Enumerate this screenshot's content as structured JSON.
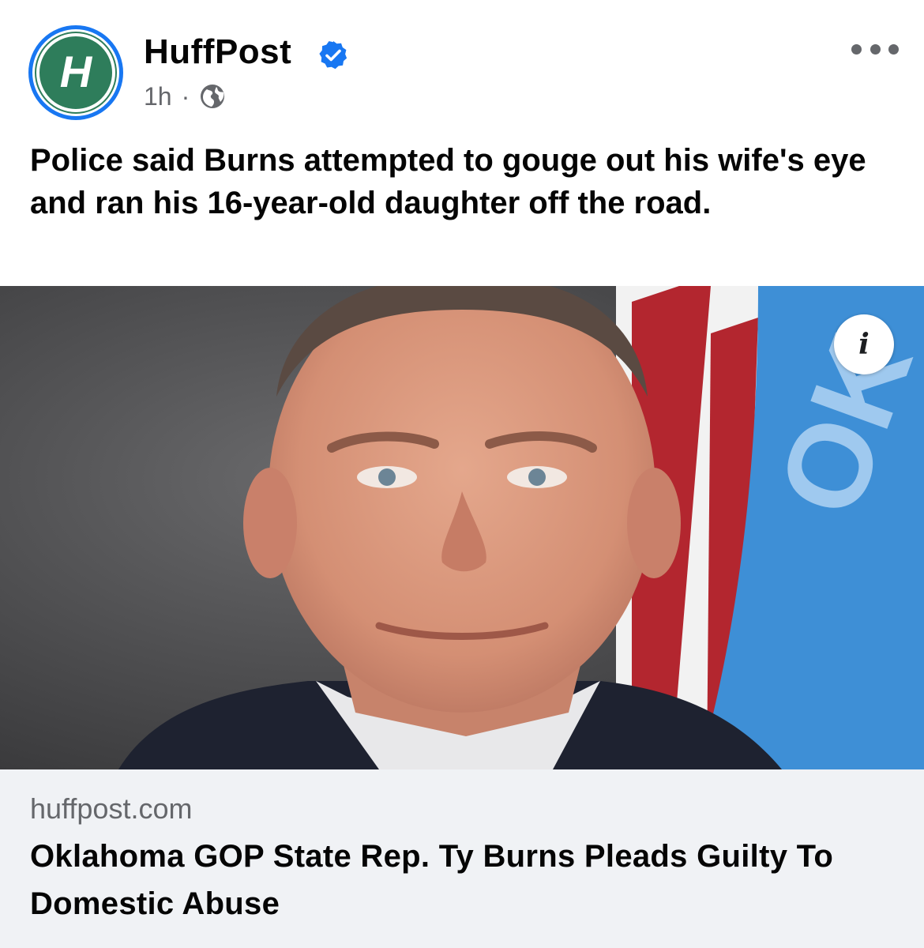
{
  "post": {
    "author": "HuffPost",
    "time": "1h",
    "separator": "·",
    "audience_icon": "globe-icon",
    "verified_icon": "verified-badge-icon",
    "caption": "Police said Burns attempted to gouge out his wife's eye and ran his 16-year-old daughter off the road."
  },
  "avatar": {
    "icon": "huffpost-logo",
    "letter": "H",
    "colors": {
      "ring": "#1877f2",
      "fill": "#2e7d5b"
    }
  },
  "photo": {
    "info_label": "i",
    "flag_lettering": "OK"
  },
  "link": {
    "domain": "huffpost.com",
    "headline": "Oklahoma GOP State Rep. Ty Burns Pleads Guilty To Domestic Abuse"
  },
  "colors": {
    "accent": "#1877f2",
    "secondary_text": "#65676b",
    "link_background": "#f0f2f5"
  }
}
